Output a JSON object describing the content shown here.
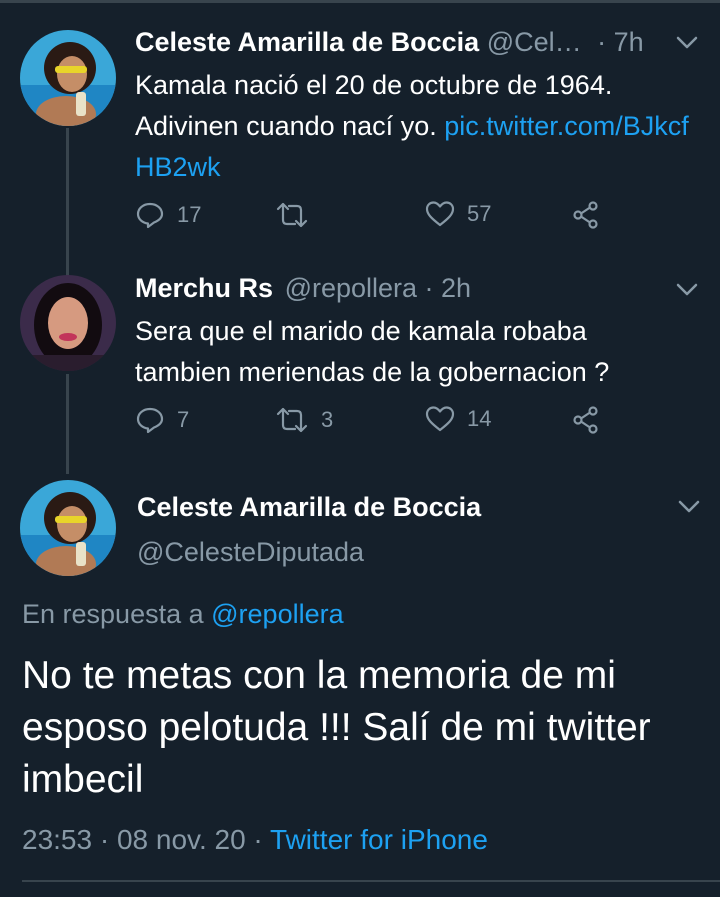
{
  "tweet1": {
    "name": "Celeste Amarilla de Boccia",
    "handle": "@Cel…",
    "time": "· 7h",
    "text": "Kamala nació el 20 de octubre de 1964. Adivinen cuando nací yo.",
    "link": "pic.twitter.com/BJkcfHB2wk",
    "replies": "17",
    "retweets": "",
    "likes": "57"
  },
  "tweet2": {
    "name": "Merchu Rs",
    "handle": "@repollera",
    "time": "· 2h",
    "text_line1": "Sera que el marido de kamala robaba",
    "text_line2": "tambien meriendas de la gobernacion ?",
    "replies": "7",
    "retweets": "3",
    "likes": "14"
  },
  "main_tweet": {
    "name": "Celeste Amarilla de Boccia",
    "handle": "@CelesteDiputada",
    "reply_prefix": "En respuesta a",
    "reply_handle": "@repollera",
    "text": "No te metas con la memoria de mi esposo pelotuda !!! Salí de mi twitter imbecil",
    "time": "23:53 · 08 nov. 20 ·",
    "source": "Twitter for iPhone"
  },
  "colors": {
    "background": "#15202b",
    "muted": "#8899a6",
    "link": "#1da1f2",
    "divider": "#38444d"
  }
}
